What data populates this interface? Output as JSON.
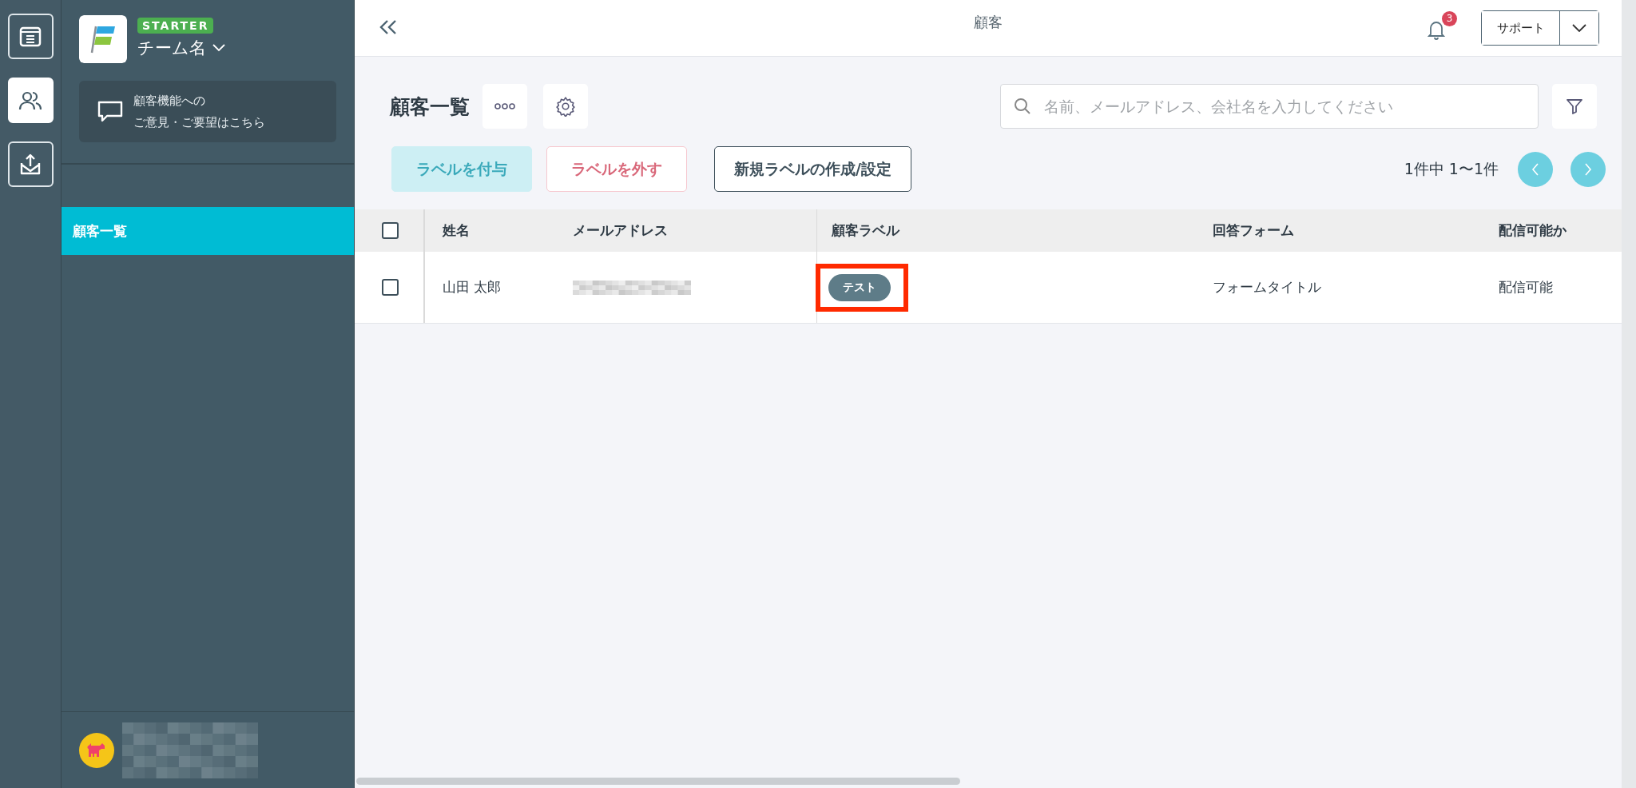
{
  "rail": [
    {
      "selected": false
    },
    {
      "selected": true
    },
    {
      "selected": false
    }
  ],
  "sidebar": {
    "plan_badge": "STARTER",
    "team_name": "チーム名",
    "feedback": [
      "顧客機能への",
      "ご意見・ご要望はこちら"
    ],
    "nav_items": [
      {
        "label": "顧客一覧",
        "selected": true
      }
    ]
  },
  "header": {
    "title": "顧客",
    "notification_count": "3",
    "support": "サポート"
  },
  "page_title": "顧客一覧",
  "search": {
    "placeholder": "名前、メールアドレス、会社名を入力してください"
  },
  "actions": [
    {
      "label": "ラベルを付与",
      "kind": "primary",
      "disabled": true
    },
    {
      "label": "ラベルを外す",
      "kind": "danger",
      "disabled": true
    },
    {
      "label": "新規ラベルの作成/設定",
      "kind": "outline",
      "disabled": false
    }
  ],
  "pagination": "1件中 1〜1件",
  "table": {
    "header_checked": false,
    "columns": [
      "姓名",
      "メールアドレス",
      "顧客ラベル",
      "回答フォーム",
      "配信可能か"
    ],
    "rows": [
      {
        "checked": false,
        "name": "山田 太郎",
        "label": "テスト",
        "label_highlighted": true,
        "form": "フォームタイトル",
        "deliverable": "配信可能"
      }
    ]
  }
}
